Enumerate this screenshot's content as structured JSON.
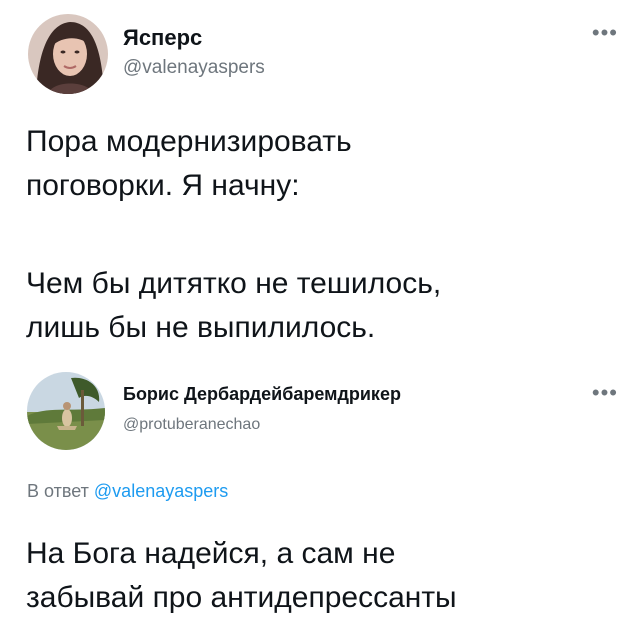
{
  "tweet1": {
    "display_name": "Ясперс",
    "handle": "@valenayaspers",
    "more_icon": "more-horizontal-icon",
    "text_lines": [
      "Пора модернизировать",
      "поговорки. Я начну:",
      "",
      "Чем бы дитятко не тешилось,",
      "лишь бы не выпилилось."
    ]
  },
  "tweet2": {
    "display_name": "Борис Дербардейбаремдрикер",
    "handle": "@protuberanechao",
    "more_icon": "more-horizontal-icon",
    "reply_prefix": "В ответ",
    "reply_mention": "@valenayaspers",
    "text_lines": [
      "На Бога надейся, а сам не",
      "забывай про антидепрессанты"
    ]
  },
  "colors": {
    "text": "#0f1419",
    "secondary": "#6e767d",
    "link": "#1d9bf0"
  }
}
